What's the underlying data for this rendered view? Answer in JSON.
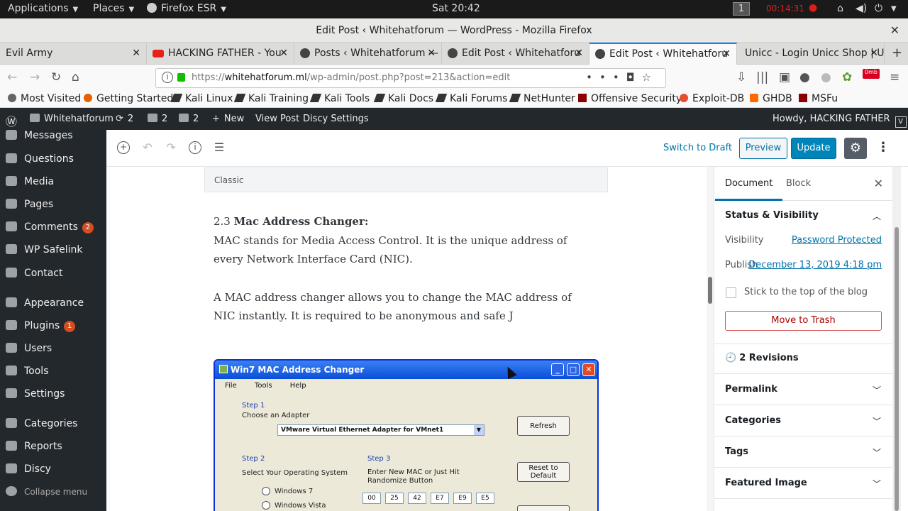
{
  "system_bar": {
    "applications": "Applications",
    "places": "Places",
    "firefox": "Firefox ESR",
    "clock": "Sat 20:42",
    "workspace": "1",
    "record_timer": "00:14:31"
  },
  "window": {
    "title": "Edit Post ‹ Whitehatforum — WordPress - Mozilla Firefox"
  },
  "tabs": [
    {
      "label": "Evil Army"
    },
    {
      "label": "HACKING FATHER - You"
    },
    {
      "label": "Posts ‹ Whitehatforum —"
    },
    {
      "label": "Edit Post ‹ Whitehatforu"
    },
    {
      "label": "Edit Post ‹ Whitehatforu"
    },
    {
      "label": "Unicc - Login Unicc Shop | U"
    }
  ],
  "url": {
    "prefix": "https://",
    "domain": "whitehatforum.ml",
    "path": "/wp-admin/post.php?post=213&action=edit"
  },
  "bookmarks": [
    {
      "label": "Most Visited"
    },
    {
      "label": "Getting Started"
    },
    {
      "label": "Kali Linux"
    },
    {
      "label": "Kali Training"
    },
    {
      "label": "Kali Tools"
    },
    {
      "label": "Kali Docs"
    },
    {
      "label": "Kali Forums"
    },
    {
      "label": "NetHunter"
    },
    {
      "label": "Offensive Security"
    },
    {
      "label": "Exploit-DB"
    },
    {
      "label": "GHDB"
    },
    {
      "label": "MSFu"
    }
  ],
  "adminbar": {
    "site": "Whitehatforum",
    "updates": "2",
    "comments": "2",
    "pending": "2",
    "new": "New",
    "view_post": "View Post",
    "disci": "Discy Settings",
    "howdy": "Howdy, HACKING FATHER"
  },
  "sidebar": {
    "items": [
      {
        "label": "Messages"
      },
      {
        "label": "Questions"
      },
      {
        "label": "Media"
      },
      {
        "label": "Pages"
      },
      {
        "label": "Comments",
        "badge": "2"
      },
      {
        "label": "WP Safelink"
      },
      {
        "label": "Contact"
      },
      {
        "label": "Appearance"
      },
      {
        "label": "Plugins",
        "badge": "1"
      },
      {
        "label": "Users"
      },
      {
        "label": "Tools"
      },
      {
        "label": "Settings"
      },
      {
        "label": "Categories"
      },
      {
        "label": "Reports"
      },
      {
        "label": "Discy"
      },
      {
        "label": "Collapse menu"
      }
    ]
  },
  "toolbar": {
    "switch_draft": "Switch to Draft",
    "preview": "Preview",
    "update": "Update"
  },
  "content": {
    "classic_label": "Classic",
    "heading_num": "2.3 ",
    "heading_bold": "Mac Address Changer:",
    "para1": "MAC stands for Media Access Control. It is the unique address of every Network Interface Card (NIC).",
    "para2": "A MAC address changer allows you to change the MAC address of NIC instantly. It is required to be anonymous and safe J"
  },
  "mac_window": {
    "title": "Win7 MAC Address Changer",
    "menu": [
      "File",
      "Tools",
      "Help"
    ],
    "step1": "Step 1",
    "choose_adapter": "Choose an Adapter",
    "adapter": "VMware Virtual Ethernet Adapter for VMnet1",
    "refresh": "Refresh",
    "step2": "Step 2",
    "select_os": "Select Your Operating System",
    "step3": "Step 3",
    "enter_mac_1": "Enter New MAC or Just Hit",
    "enter_mac_2": "Randomize Button",
    "reset_1": "Reset to",
    "reset_2": "Default",
    "os1": "Windows 7",
    "os2": "Windows Vista",
    "mac": [
      "00",
      "25",
      "42",
      "E7",
      "E9",
      "E5"
    ]
  },
  "panel": {
    "tab_document": "Document",
    "tab_block": "Block",
    "status_title": "Status & Visibility",
    "visibility_label": "Visibility",
    "visibility_value": "Password Protected",
    "publish_label": "Publish",
    "publish_value": "December 13, 2019 4:18 pm",
    "stick_label": "Stick to the top of the blog",
    "trash": "Move to Trash",
    "revisions": "2 Revisions",
    "permalink": "Permalink",
    "categories": "Categories",
    "tags": "Tags",
    "featured": "Featured Image"
  }
}
